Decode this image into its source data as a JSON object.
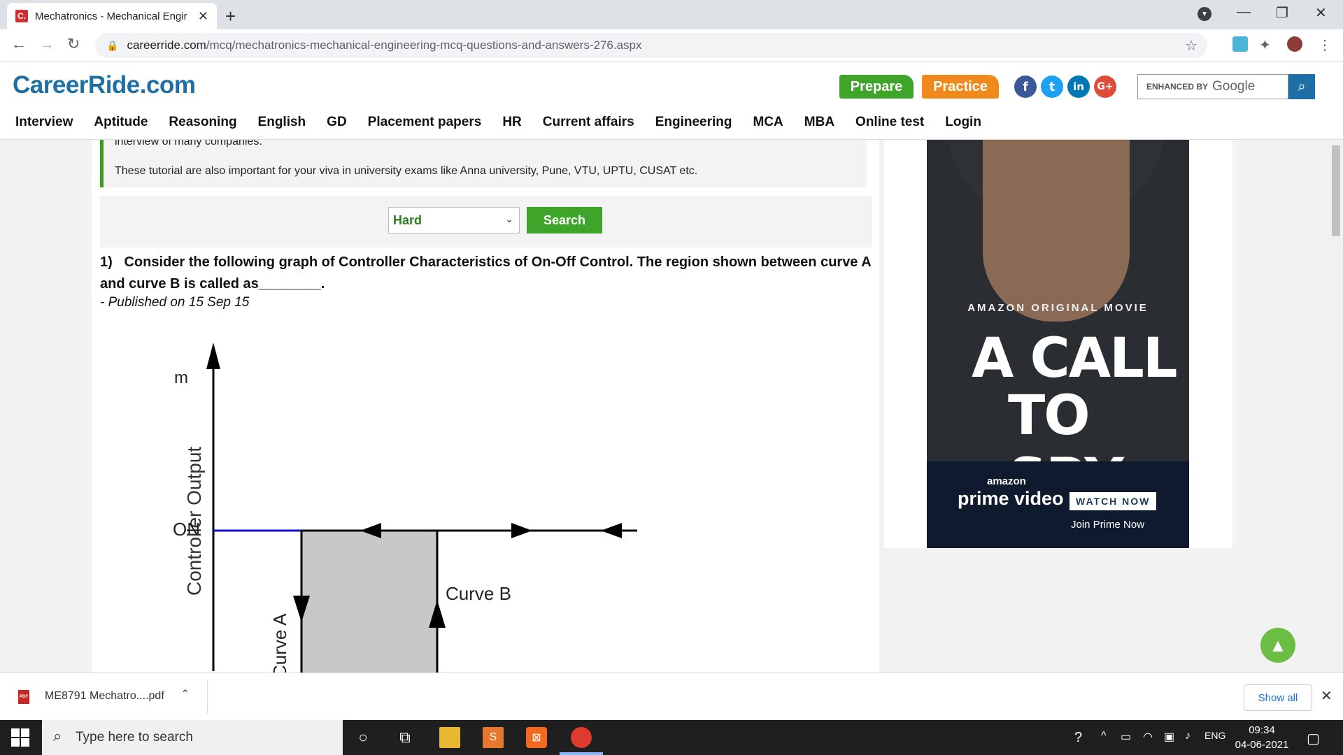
{
  "browser": {
    "tab_title": "Mechatronics - Mechanical Engir",
    "favicon_letter": "C.",
    "url_host": "careerride.com",
    "url_path": "/mcq/mechatronics-mechanical-engineering-mcq-questions-and-answers-276.aspx"
  },
  "site": {
    "logo": "CareerRide.com",
    "prepare_label": "Prepare",
    "practice_label": "Practice",
    "social": [
      "f",
      "t",
      "in",
      "G+"
    ],
    "search_enhanced": "ENHANCED BY",
    "search_google": "Google",
    "nav": [
      "Interview",
      "Aptitude",
      "Reasoning",
      "English",
      "GD",
      "Placement papers",
      "HR",
      "Current affairs",
      "Engineering",
      "MCA",
      "MBA",
      "Online test",
      "Login"
    ]
  },
  "content": {
    "intro_cut": "interview of many companies.",
    "intro_line": "These tutorial are also important for your viva in university exams like Anna university, Pune, VTU, UPTU, CUSAT etc.",
    "difficulty_selected": "Hard",
    "search_button": "Search",
    "question_number": "1)",
    "question_text": "Consider the following graph of Controller Characteristics of On-Off Control. The region shown between curve A and curve B is called as________.",
    "published": "- Published on 15 Sep 15",
    "graph": {
      "y_axis_label": "Controller Output",
      "y_axis_top": "m",
      "on_label": "ON",
      "curve_a": "Curve A",
      "curve_b": "Curve B"
    }
  },
  "ad": {
    "tagline": "AMAZON ORIGINAL MOVIE",
    "title_line1": "A CALL",
    "title_line2": "TO SPY",
    "amazon": "amazon",
    "prime": "prime video",
    "watch_now": "WATCH NOW",
    "join": "Join Prime Now"
  },
  "download": {
    "file_name": "ME8791 Mechatro....pdf",
    "show_all": "Show all"
  },
  "taskbar": {
    "search_placeholder": "Type here to search",
    "lang": "ENG",
    "time": "09:34",
    "date": "04-06-2021"
  },
  "colors": {
    "brand_blue": "#1d6fa5",
    "green": "#3fa52a",
    "orange": "#f08a1c"
  }
}
